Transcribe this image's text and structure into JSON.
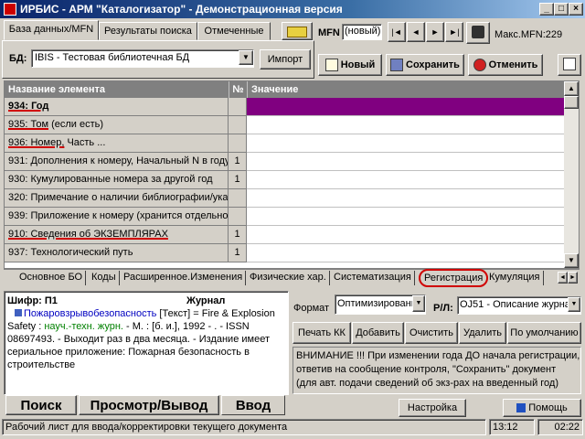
{
  "title": "ИРБИС - АРМ \"Каталогизатор\" - Демонстрационная версия",
  "tabs": [
    "База данных/MFN",
    "Результаты поиска",
    "Отмеченные"
  ],
  "mfn": {
    "label": "MFN",
    "value": "(новый)",
    "max_label": "Макс.MFN:229"
  },
  "nav_buttons": [
    "|◄",
    "◄",
    "►",
    "►|"
  ],
  "db": {
    "label": "БД:",
    "value": "IBIS - Тестовая библиотечная БД",
    "import_label": "Импорт"
  },
  "actions": {
    "new": "Новый",
    "save": "Сохранить",
    "cancel": "Отменить"
  },
  "grid": {
    "headers": [
      "Название элемента",
      "№",
      "Значение"
    ],
    "rows": [
      {
        "name": "934: Год",
        "num": "",
        "bold": true,
        "highlight": true
      },
      {
        "name": "935: Том (если есть)",
        "num": ""
      },
      {
        "name": "936: Номер, Часть ...",
        "num": ""
      },
      {
        "name": "931: Дополнения к номеру, Начальный N в году",
        "num": "1"
      },
      {
        "name": "930: Кумулированные номера за другой год",
        "num": "1"
      },
      {
        "name": "320: Примечание о наличии библиографии/указ",
        "num": ""
      },
      {
        "name": "939: Приложение к номеру (хранится отдельно",
        "num": ""
      },
      {
        "name": "910: Сведения  об  ЭКЗЕМПЛЯРАХ",
        "num": "1"
      },
      {
        "name": "937: Технологический путь",
        "num": "1"
      }
    ]
  },
  "worksheet_tabs": [
    "Основное БО",
    "Коды",
    "Расширенное.Изменения",
    "Физические хар.",
    "Систематизация",
    "Регистрация",
    "Кумуляция"
  ],
  "record": {
    "shifr": "Шифр: П1",
    "type": "Журнал",
    "title_link": "Пожаровзрывобезопасность",
    "line1_rest": " [Текст] = Fire & Explosion",
    "line2_start": "Safety : ",
    "line2_green": "науч.-техн. журн.",
    "line2_rest": " - М. : [б. и.], 1992 - . - ISSN",
    "line3": "08697493. - Выходит раз в два месяца. - Издание имеет",
    "line4": "сериальное приложение: Пожарная безопасность в",
    "line5": "строительстве"
  },
  "format": {
    "label": "Формат",
    "value": "Оптимизированн",
    "rl_label": "Р/Л:",
    "rl_value": "OJ51 - Описание журна"
  },
  "bottom_buttons": [
    "Печать КК",
    "Добавить",
    "Очистить",
    "Удалить",
    "По умолчанию"
  ],
  "warning": {
    "line1": "ВНИМАНИЕ !!! При изменении года ДО начала регистрации,",
    "line2": "ответив на сообщение контроля, \"Сохранить\" документ",
    "line3": "(для авт. подачи сведений об экз-рах на введенный год)"
  },
  "section_tabs": [
    "Поиск",
    "Просмотр/Вывод",
    "Ввод"
  ],
  "settings_label": "Настройка",
  "help_label": "Помощь",
  "status": {
    "text": "Рабочий лист для ввода/корректировки текущего документа",
    "keys": "13:12",
    "time": "02:22"
  },
  "colors": {
    "highlight": "#800080",
    "accent_red": "#d00000",
    "link": "#0000c0",
    "green": "#008000"
  }
}
